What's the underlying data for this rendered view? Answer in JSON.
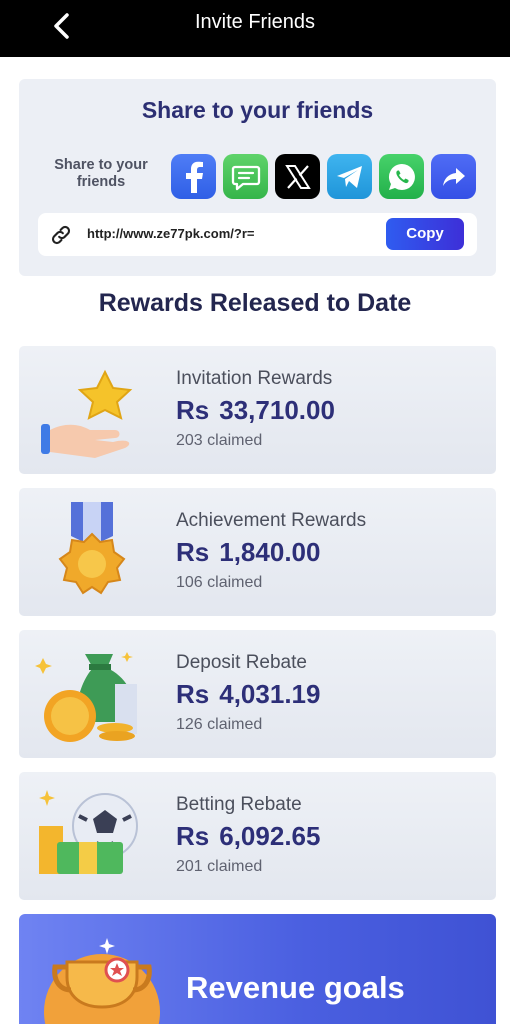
{
  "header": {
    "title": "Invite Friends"
  },
  "share": {
    "title": "Share to your friends",
    "label": "Share to your friends",
    "url": "http://www.ze77pk.com/?r=",
    "copy_label": "Copy",
    "platforms": [
      "facebook-icon",
      "sms-icon",
      "x-icon",
      "telegram-icon",
      "whatsapp-icon",
      "forward-icon"
    ]
  },
  "rewards_title": "Rewards Released to Date",
  "rewards": [
    {
      "name": "Invitation Rewards",
      "currency": "Rs",
      "amount": "33,710.00",
      "claimed": "203 claimed",
      "icon": "star-hand-icon"
    },
    {
      "name": "Achievement Rewards",
      "currency": "Rs",
      "amount": "1,840.00",
      "claimed": "106 claimed",
      "icon": "medal-icon"
    },
    {
      "name": "Deposit Rebate",
      "currency": "Rs",
      "amount": "4,031.19",
      "claimed": "126 claimed",
      "icon": "money-bag-icon"
    },
    {
      "name": "Betting Rebate",
      "currency": "Rs",
      "amount": "6,092.65",
      "claimed": "201 claimed",
      "icon": "soccer-cash-icon"
    }
  ],
  "revenue": {
    "label": "Revenue goals"
  },
  "colors": {
    "accent": "#2d2f78",
    "copy_button": "#3342e0",
    "topbar": "#000000"
  }
}
